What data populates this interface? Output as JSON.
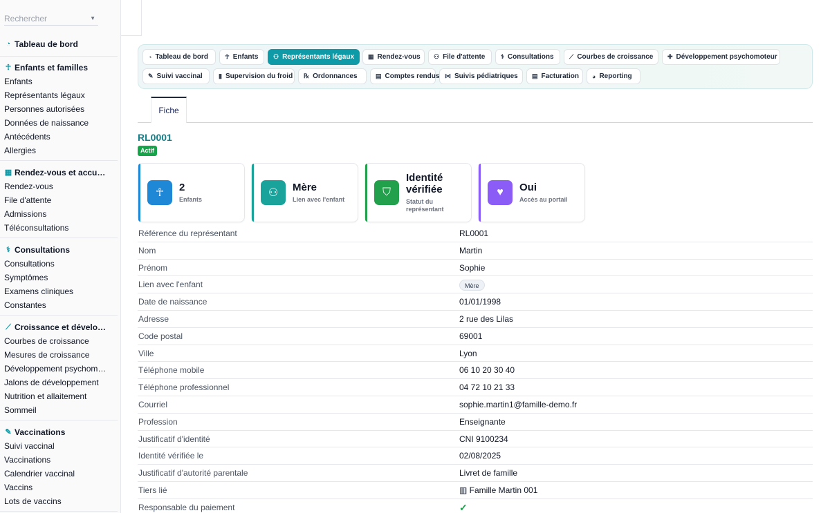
{
  "search": {
    "placeholder": "Rechercher"
  },
  "sidebar": {
    "dashboard": "Tableau de bord",
    "sections": [
      {
        "title": "Enfants et familles",
        "icon": "child-icon",
        "items": [
          "Enfants",
          "Représentants légaux",
          "Personnes autorisées",
          "Données de naissance",
          "Antécédents",
          "Allergies"
        ]
      },
      {
        "title": "Rendez-vous et accu…",
        "icon": "calendar-icon",
        "items": [
          "Rendez-vous",
          "File d'attente",
          "Admissions",
          "Téléconsultations"
        ]
      },
      {
        "title": "Consultations",
        "icon": "stethoscope-icon",
        "items": [
          "Consultations",
          "Symptômes",
          "Examens cliniques",
          "Constantes"
        ]
      },
      {
        "title": "Croissance et dévelo…",
        "icon": "chart-line-icon",
        "items": [
          "Courbes de croissance",
          "Mesures de croissance",
          "Développement psychom…",
          "Jalons de développement",
          "Nutrition et allaitement",
          "Sommeil"
        ]
      },
      {
        "title": "Vaccinations",
        "icon": "syringe-icon",
        "items": [
          "Suivi vaccinal",
          "Vaccinations",
          "Calendrier vaccinal",
          "Vaccins",
          "Lots de vaccins"
        ]
      }
    ]
  },
  "nav": {
    "row1": [
      {
        "label": "Tableau de bord",
        "icon": "gauge-icon"
      },
      {
        "label": "Enfants",
        "icon": "child-icon"
      },
      {
        "label": "Représentants légaux",
        "icon": "users-icon",
        "active": true
      },
      {
        "label": "Rendez-vous",
        "icon": "calendar-icon"
      },
      {
        "label": "File d'attente",
        "icon": "queue-icon"
      },
      {
        "label": "Consultations",
        "icon": "stethoscope-icon"
      },
      {
        "label": "Courbes de croissance",
        "icon": "chart-line-icon"
      },
      {
        "label": "Développement psychomoteur",
        "icon": "puzzle-icon"
      }
    ],
    "row2": [
      {
        "label": "Suivi vaccinal",
        "icon": "syringe-icon"
      },
      {
        "label": "Supervision du froid",
        "icon": "thermometer-icon"
      },
      {
        "label": "Ordonnances",
        "icon": "prescription-icon"
      },
      {
        "label": "Comptes rendus",
        "icon": "file-icon"
      },
      {
        "label": "Suivis pédiatriques",
        "icon": "network-icon"
      },
      {
        "label": "Facturation",
        "icon": "invoice-icon"
      },
      {
        "label": "Reporting",
        "icon": "pie-chart-icon"
      }
    ]
  },
  "tabs": {
    "fiche": "Fiche"
  },
  "record": {
    "title": "RL0001",
    "status": "Actif"
  },
  "cards": [
    {
      "value": "2",
      "label": "Enfants",
      "icon": "child-icon",
      "color": "#1e88d6"
    },
    {
      "value": "Mère",
      "label": "Lien avec l'enfant",
      "icon": "users-icon",
      "color": "#1aa39a"
    },
    {
      "value": "Identité vérifiée",
      "label": "Statut du représentant",
      "icon": "user-shield-icon",
      "color": "#22a04b"
    },
    {
      "value": "Oui",
      "label": "Accès au portail",
      "icon": "hand-heart-icon",
      "color": "#8b5cf6"
    }
  ],
  "details": [
    {
      "label": "Référence du représentant",
      "value": "RL0001"
    },
    {
      "label": "Nom",
      "value": "Martin"
    },
    {
      "label": "Prénom",
      "value": "Sophie"
    },
    {
      "label": "Lien avec l'enfant",
      "value": "Mère",
      "kind": "chip"
    },
    {
      "label": "Date de naissance",
      "value": "01/01/1998"
    },
    {
      "label": "Adresse",
      "value": "2 rue des Lilas"
    },
    {
      "label": "Code postal",
      "value": "69001"
    },
    {
      "label": "Ville",
      "value": "Lyon"
    },
    {
      "label": "Téléphone mobile",
      "value": "06 10 20 30 40"
    },
    {
      "label": "Téléphone professionnel",
      "value": "04 72 10 21 33"
    },
    {
      "label": "Courriel",
      "value": "sophie.martin1@famille-demo.fr"
    },
    {
      "label": "Profession",
      "value": "Enseignante"
    },
    {
      "label": "Justificatif d'identité",
      "value": "CNI 9100234"
    },
    {
      "label": "Identité vérifiée le",
      "value": "02/08/2025"
    },
    {
      "label": "Justificatif d'autorité parentale",
      "value": "Livret de famille"
    },
    {
      "label": "Tiers lié",
      "value": "Famille Martin 001",
      "kind": "link"
    },
    {
      "label": "Responsable du paiement",
      "value": "",
      "kind": "check"
    }
  ]
}
